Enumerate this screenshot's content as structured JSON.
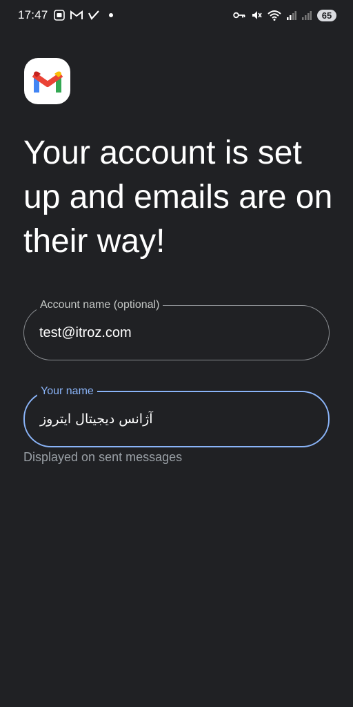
{
  "status_bar": {
    "time": "17:47",
    "battery": "65",
    "left_icons": [
      "screenshot-icon",
      "gmail-notification-icon",
      "checkmark-icon",
      "dot-icon"
    ],
    "right_icons": [
      "key-icon",
      "mute-icon",
      "wifi-icon",
      "signal-icon",
      "signal-icon-2",
      "battery-icon"
    ]
  },
  "app": {
    "logo": "gmail-logo",
    "headline": "Your account is set up and emails are on their way!"
  },
  "form": {
    "account_name": {
      "label": "Account name (optional)",
      "value": "test@itroz.com"
    },
    "your_name": {
      "label": "Your name",
      "value": "آژانس دیجیتال ایتروز",
      "helper": "Displayed on sent messages"
    }
  },
  "colors": {
    "background": "#202124",
    "focus_accent": "#8ab4f8",
    "outline": "#8a8d91",
    "helper": "#9aa0a6"
  }
}
